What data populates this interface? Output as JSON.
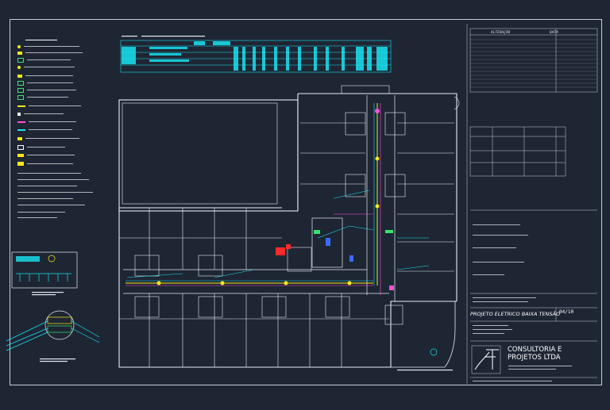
{
  "revision_table": {
    "col_alteracao": "ALTERAÇÃO",
    "col_data": "DATA"
  },
  "title_block": {
    "company_line1": "CONSULTORIA E",
    "company_line2": "PROJETOS LTDA",
    "project_title": "PROJETO ELETRICO BAIXA TENSÃO",
    "sheet_number": "04/10"
  },
  "colors": {
    "background": "#1e2634",
    "frame": "#c8cdd6",
    "walls": "#e8ecf2",
    "cyan": "#19e3f2",
    "yellow": "#ffe71a",
    "magenta": "#ff4fd8",
    "red": "#ff2a2a",
    "blue": "#3b6cff",
    "green": "#39e36b"
  }
}
